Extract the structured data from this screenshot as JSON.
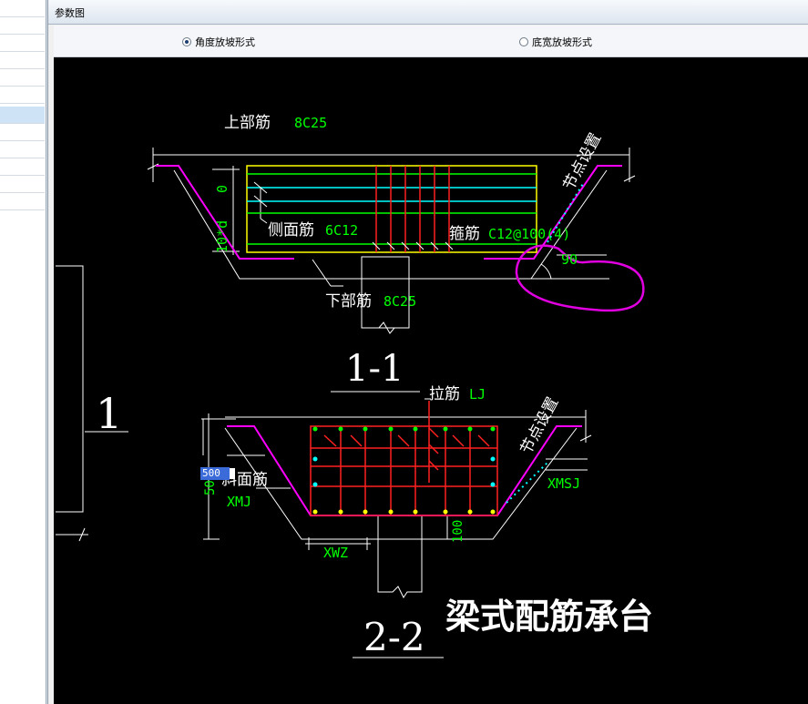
{
  "window": {
    "title": "参数图"
  },
  "options": [
    {
      "label": "角度放坡形式",
      "selected": true
    },
    {
      "label": "底宽放坡形式",
      "selected": false
    }
  ],
  "diagram": {
    "section_1_label": "1-1",
    "section_2_label": "2-2",
    "side_label": "1",
    "main_title": "梁式配筋承台",
    "top_bar_label": "上部筋",
    "top_bar_value": "8C25",
    "side_bar_label": "侧面筋",
    "side_bar_value": "6C12",
    "stirrup_label": "箍筋",
    "stirrup_value": "C12@100(4)",
    "bottom_bar_label": "下部筋",
    "bottom_bar_value": "8C25",
    "node_setting_1": "节点设置",
    "node_setting_2": "节点设置",
    "angle_value": "90",
    "dim_zero": "0",
    "dim_10d": "10*d",
    "tie_bar_label": "拉筋",
    "tie_bar_value": "LJ",
    "slope_bar_label": "斜面筋",
    "slope_bar_value": "XMJ",
    "xmsj_label": "XMSJ",
    "xwz_label": "XWZ",
    "dim_100": "100",
    "dim_50": "50",
    "edit_value": "500"
  }
}
